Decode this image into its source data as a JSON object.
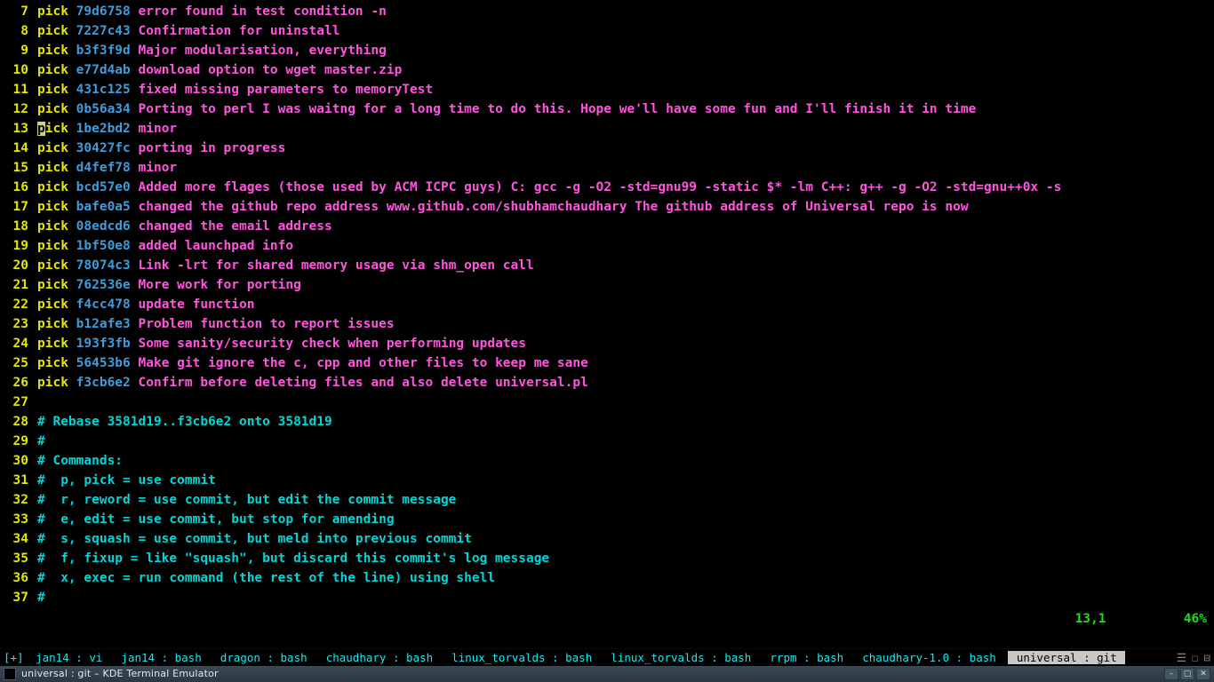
{
  "editor": {
    "lines": [
      {
        "n": 7,
        "kind": "pick",
        "cmd": "pick",
        "hash": "79d6758",
        "msg": "error found in test condition -n"
      },
      {
        "n": 8,
        "kind": "pick",
        "cmd": "pick",
        "hash": "7227c43",
        "msg": "Confirmation for uninstall"
      },
      {
        "n": 9,
        "kind": "pick",
        "cmd": "pick",
        "hash": "b3f3f9d",
        "msg": "Major modularisation, everything"
      },
      {
        "n": 10,
        "kind": "pick",
        "cmd": "pick",
        "hash": "e77d4ab",
        "msg": "download option to wget master.zip"
      },
      {
        "n": 11,
        "kind": "pick",
        "cmd": "pick",
        "hash": "431c125",
        "msg": "fixed missing parameters to memoryTest"
      },
      {
        "n": 12,
        "kind": "pick",
        "cmd": "pick",
        "hash": "0b56a34",
        "msg": "Porting to perl I was waitng for a long time to do this. Hope we'll have some fun and I'll finish it in time"
      },
      {
        "n": 13,
        "kind": "pick-cursor",
        "cmd_pre": "p",
        "cmd_post": "ick",
        "hash": "1be2bd2",
        "msg": "minor"
      },
      {
        "n": 14,
        "kind": "pick",
        "cmd": "pick",
        "hash": "30427fc",
        "msg": "porting in progress"
      },
      {
        "n": 15,
        "kind": "pick",
        "cmd": "pick",
        "hash": "d4fef78",
        "msg": "minor"
      },
      {
        "n": 16,
        "kind": "pick",
        "cmd": "pick",
        "hash": "bcd57e0",
        "msg": "Added more flages (those used by ACM ICPC guys) C: gcc -g -O2 -std=gnu99 -static $* -lm C++: g++ -g -O2 -std=gnu++0x -s"
      },
      {
        "n": 17,
        "kind": "pick",
        "cmd": "pick",
        "hash": "bafe0a5",
        "msg": "changed the github repo address www.github.com/shubhamchaudhary The github address of Universal repo is now"
      },
      {
        "n": 18,
        "kind": "pick",
        "cmd": "pick",
        "hash": "08edcd6",
        "msg": "changed the email address"
      },
      {
        "n": 19,
        "kind": "pick",
        "cmd": "pick",
        "hash": "1bf50e8",
        "msg": "added launchpad info"
      },
      {
        "n": 20,
        "kind": "pick",
        "cmd": "pick",
        "hash": "78074c3",
        "msg": "Link -lrt for shared memory usage via shm_open call"
      },
      {
        "n": 21,
        "kind": "pick",
        "cmd": "pick",
        "hash": "762536e",
        "msg": "More work for porting"
      },
      {
        "n": 22,
        "kind": "pick",
        "cmd": "pick",
        "hash": "f4cc478",
        "msg": "update function"
      },
      {
        "n": 23,
        "kind": "pick",
        "cmd": "pick",
        "hash": "b12afe3",
        "msg": "Problem function to report issues"
      },
      {
        "n": 24,
        "kind": "pick",
        "cmd": "pick",
        "hash": "193f3fb",
        "msg": "Some sanity/security check when performing updates"
      },
      {
        "n": 25,
        "kind": "pick",
        "cmd": "pick",
        "hash": "56453b6",
        "msg": "Make git ignore the c, cpp and other files to keep me sane"
      },
      {
        "n": 26,
        "kind": "pick",
        "cmd": "pick",
        "hash": "f3cb6e2",
        "msg": "Confirm before deleting files and also delete universal.pl"
      },
      {
        "n": 27,
        "kind": "blank"
      },
      {
        "n": 28,
        "kind": "comment",
        "text": "# Rebase 3581d19..f3cb6e2 onto 3581d19"
      },
      {
        "n": 29,
        "kind": "comment",
        "text": "#"
      },
      {
        "n": 30,
        "kind": "comment",
        "text": "# Commands:"
      },
      {
        "n": 31,
        "kind": "comment",
        "text": "#  p, pick = use commit"
      },
      {
        "n": 32,
        "kind": "comment",
        "text": "#  r, reword = use commit, but edit the commit message"
      },
      {
        "n": 33,
        "kind": "comment",
        "text": "#  e, edit = use commit, but stop for amending"
      },
      {
        "n": 34,
        "kind": "comment",
        "text": "#  s, squash = use commit, but meld into previous commit"
      },
      {
        "n": 35,
        "kind": "comment",
        "text": "#  f, fixup = like \"squash\", but discard this commit's log message"
      },
      {
        "n": 36,
        "kind": "comment",
        "text": "#  x, exec = run command (the rest of the line) using shell"
      },
      {
        "n": 37,
        "kind": "comment",
        "text": "#"
      }
    ]
  },
  "status": {
    "pos": "13,1",
    "pct": "46%"
  },
  "tmux": {
    "corner": "[+]",
    "tabs": [
      {
        "name": "jan14",
        "proc": "vi",
        "active": false
      },
      {
        "name": "jan14",
        "proc": "bash",
        "active": false
      },
      {
        "name": "dragon",
        "proc": "bash",
        "active": false
      },
      {
        "name": "chaudhary",
        "proc": "bash",
        "active": false
      },
      {
        "name": "linux_torvalds",
        "proc": "bash",
        "active": false
      },
      {
        "name": "linux_torvalds",
        "proc": "bash",
        "active": false
      },
      {
        "name": "rrpm",
        "proc": "bash",
        "active": false
      },
      {
        "name": "chaudhary-1.0",
        "proc": "bash",
        "active": false
      },
      {
        "name": "universal",
        "proc": "git",
        "active": true
      }
    ],
    "right_syms": [
      "☰",
      "☐",
      "⊟"
    ]
  },
  "titlebar": {
    "title": "universal : git – KDE Terminal Emulator",
    "buttons": {
      "min": "–",
      "max": "▢",
      "close": "✕"
    }
  }
}
